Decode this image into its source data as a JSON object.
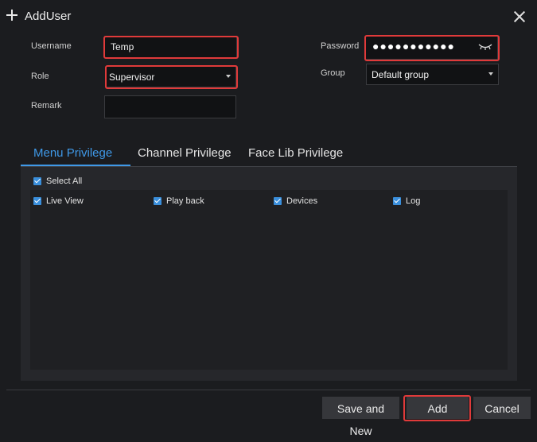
{
  "dialog": {
    "title": "AddUser"
  },
  "form": {
    "username_label": "Username",
    "username_value": "Temp",
    "password_label": "Password",
    "password_mask": "●●●●●●●●●●●",
    "role_label": "Role",
    "role_value": "Supervisor",
    "group_label": "Group",
    "group_value": "Default group",
    "remark_label": "Remark",
    "remark_value": ""
  },
  "tabs": [
    {
      "label": "Menu Privilege",
      "active": true
    },
    {
      "label": "Channel Privilege",
      "active": false
    },
    {
      "label": "Face Lib Privilege",
      "active": false
    }
  ],
  "privileges": {
    "select_all_label": "Select All",
    "items": [
      {
        "label": "Live View",
        "checked": true
      },
      {
        "label": "Play back",
        "checked": true
      },
      {
        "label": "Devices",
        "checked": true
      },
      {
        "label": "Log",
        "checked": true
      }
    ]
  },
  "footer": {
    "save_new_label": "Save and New",
    "add_label": "Add",
    "cancel_label": "Cancel"
  },
  "colors": {
    "accent": "#3f99e8",
    "highlight": "#e03a3a",
    "background": "#1b1c1f"
  },
  "icons": {
    "title": "plus-icon",
    "close": "close-icon",
    "password": "eye-closed-icon",
    "select": "chevron-down-icon",
    "checkbox": "checkbox-checked-icon"
  }
}
